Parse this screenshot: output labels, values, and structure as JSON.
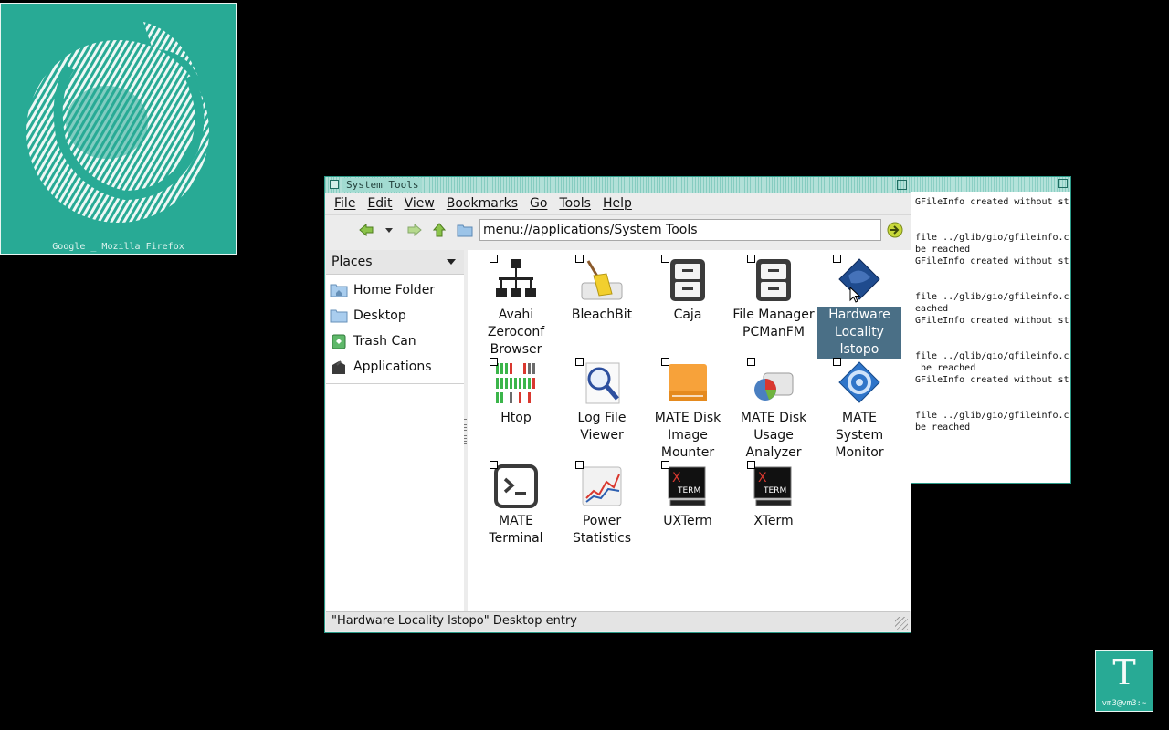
{
  "firefox_thumb": {
    "caption": "Google _ Mozilla Firefox"
  },
  "terminal_icon": {
    "glyph": "T",
    "caption": "vm3@vm3:~"
  },
  "log_window": {
    "lines": [
      "GFileInfo created without st",
      "",
      "",
      "file ../glib/gio/gfileinfo.c",
      "be reached",
      "GFileInfo created without st",
      "",
      "",
      "file ../glib/gio/gfileinfo.c",
      "eached",
      "GFileInfo created without st",
      "",
      "",
      "file ../glib/gio/gfileinfo.c",
      " be reached",
      "GFileInfo created without st",
      "",
      "",
      "file ../glib/gio/gfileinfo.c",
      "be reached"
    ]
  },
  "window": {
    "title": "System Tools",
    "menu": [
      "File",
      "Edit",
      "View",
      "Bookmarks",
      "Go",
      "Tools",
      "Help"
    ],
    "location": "menu://applications/System Tools",
    "sidebar": {
      "header": "Places",
      "items": [
        {
          "label": "Home Folder",
          "icon": "folder-home-icon"
        },
        {
          "label": "Desktop",
          "icon": "folder-desktop-icon"
        },
        {
          "label": "Trash Can",
          "icon": "trash-icon"
        },
        {
          "label": "Applications",
          "icon": "applications-icon"
        }
      ]
    },
    "items": [
      {
        "label": "Avahi\nZeroconf\nBrowser",
        "icon": "network-icon"
      },
      {
        "label": "BleachBit",
        "icon": "broom-icon"
      },
      {
        "label": "Caja",
        "icon": "file-cabinet-icon"
      },
      {
        "label": "File Manager\nPCManFM",
        "icon": "file-cabinet-icon"
      },
      {
        "label": "Hardware\nLocality\nlstopo",
        "icon": "hwloc-icon",
        "selected": true
      },
      {
        "label": "Htop",
        "icon": "htop-icon"
      },
      {
        "label": "Log File\nViewer",
        "icon": "log-viewer-icon"
      },
      {
        "label": "MATE Disk\nImage\nMounter",
        "icon": "disk-image-icon"
      },
      {
        "label": "MATE Disk\nUsage\nAnalyzer",
        "icon": "disk-usage-icon"
      },
      {
        "label": "MATE\nSystem\nMonitor",
        "icon": "system-monitor-icon"
      },
      {
        "label": "MATE\nTerminal",
        "icon": "terminal-icon"
      },
      {
        "label": "Power\nStatistics",
        "icon": "power-stats-icon"
      },
      {
        "label": "UXTerm",
        "icon": "xterm-icon"
      },
      {
        "label": "XTerm",
        "icon": "xterm-icon"
      }
    ],
    "status": "\"Hardware Locality lstopo\" Desktop entry"
  },
  "colors": {
    "accent": "#28aa95",
    "selection": "#4a6f86"
  }
}
